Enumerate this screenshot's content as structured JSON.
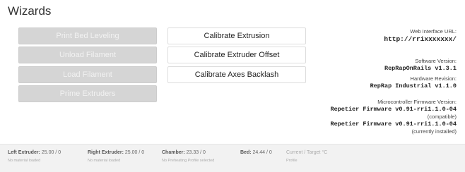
{
  "page": {
    "title": "Wizards"
  },
  "left_buttons": [
    {
      "label": "Print Bed Leveling"
    },
    {
      "label": "Unload Filament"
    },
    {
      "label": "Load Filament"
    },
    {
      "label": "Prime Extruders"
    }
  ],
  "mid_buttons": [
    {
      "label": "Calibrate Extrusion"
    },
    {
      "label": "Calibrate Extruder Offset"
    },
    {
      "label": "Calibrate Axes Backlash"
    }
  ],
  "info": {
    "web_label": "Web Interface URL:",
    "web_value": "http://rrixxxxxxx/",
    "software_label": "Software Version:",
    "software_value": "RepRapOnRails v1.3.1",
    "hardware_label": "Hardware Revision:",
    "hardware_value": "RepRap Industrial v1.1.0",
    "firmware_label": "Microcontroller Firmware Version:",
    "firmware_compatible_value": "Repetier Firmware v0.91-rri1.1.0-04",
    "firmware_compatible_note": "(compatible)",
    "firmware_installed_value": "Repetier Firmware v0.91-rri1.1.0-04",
    "firmware_installed_note": "(currently installed)"
  },
  "footer": {
    "left_extruder": {
      "label": "Left Extruder:",
      "value": "25.00 / 0",
      "sub": "No material loaded"
    },
    "right_extruder": {
      "label": "Right Extruder:",
      "value": "25.00 / 0",
      "sub": "No material loaded"
    },
    "chamber": {
      "label": "Chamber:",
      "value": "23.33 / 0",
      "sub": "No Preheating Profile selected"
    },
    "bed": {
      "label": "Bed:",
      "value": "24.44 / 0"
    },
    "legend": {
      "label": "Current / Target °C",
      "sub": "Profile"
    }
  }
}
